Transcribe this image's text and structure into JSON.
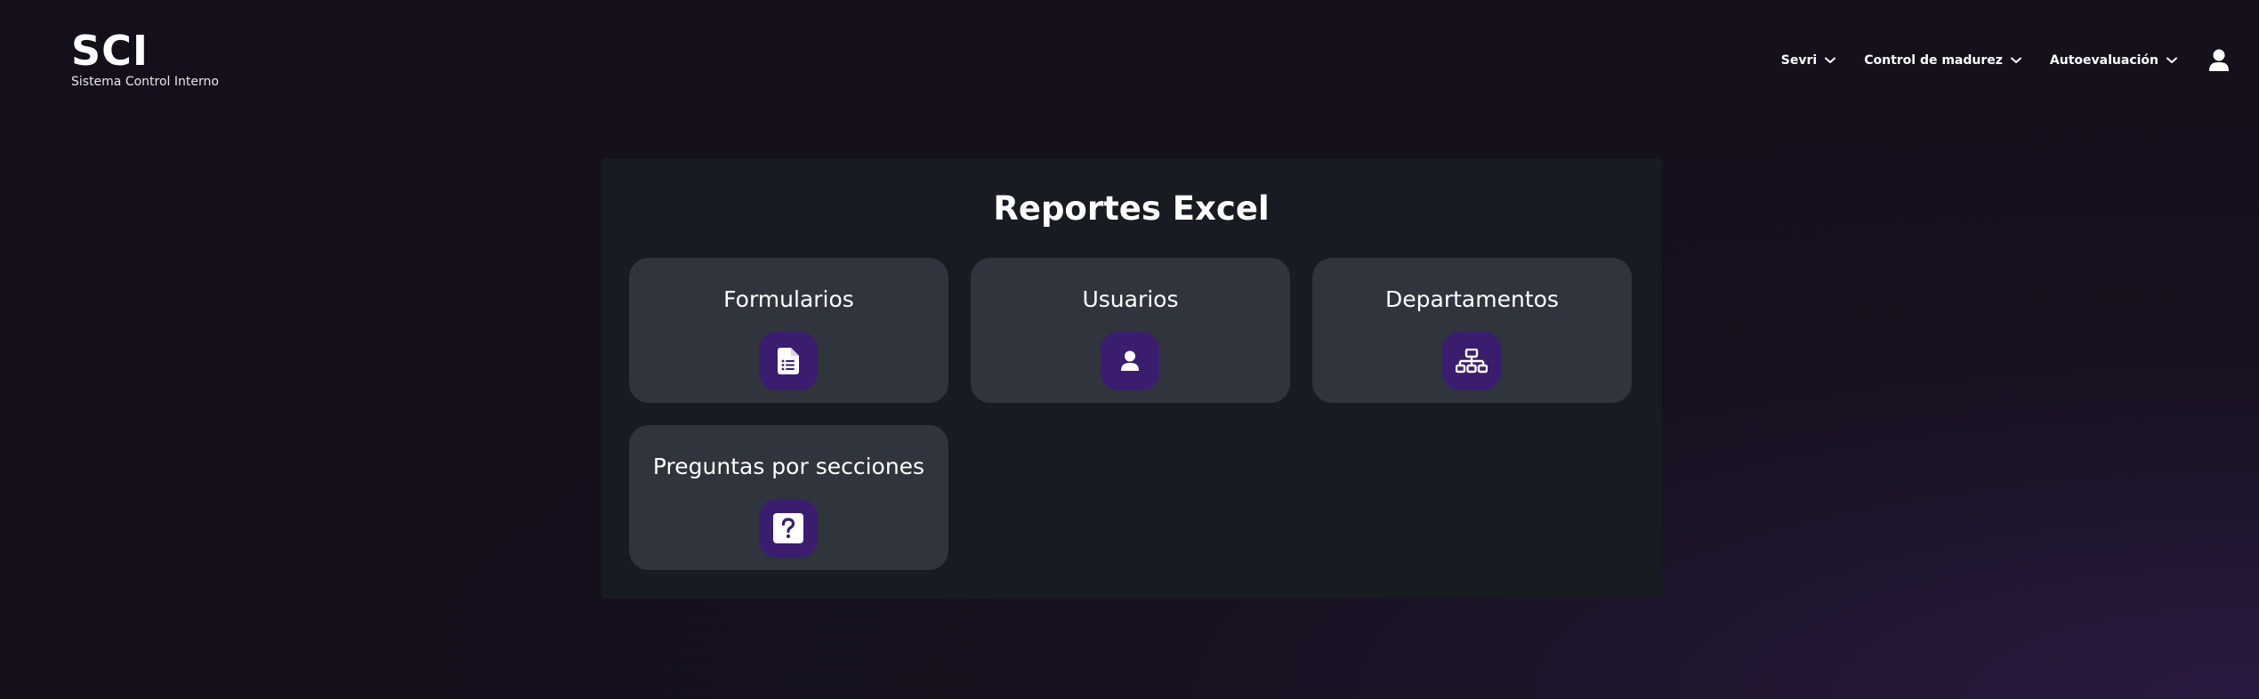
{
  "brand": {
    "title": "SCI",
    "subtitle": "Sistema Control Interno"
  },
  "nav": {
    "items": [
      {
        "label": "Sevri",
        "icon": "chevron-down-icon"
      },
      {
        "label": "Control de madurez",
        "icon": "chevron-down-icon"
      },
      {
        "label": "Autoevaluación",
        "icon": "chevron-down-icon"
      }
    ],
    "user_icon": "user-icon"
  },
  "main": {
    "title": "Reportes Excel",
    "cards": [
      {
        "label": "Formularios",
        "icon": "document-list-icon"
      },
      {
        "label": "Usuarios",
        "icon": "user-icon"
      },
      {
        "label": "Departamentos",
        "icon": "org-chart-icon"
      },
      {
        "label": "Preguntas por secciones",
        "icon": "question-mark-icon"
      }
    ]
  },
  "colors": {
    "page_background": "#140f1a",
    "panel_background": "#181b22",
    "card_background": "#30343d",
    "icon_badge": "#3a1d6e",
    "text": "#ffffff"
  }
}
